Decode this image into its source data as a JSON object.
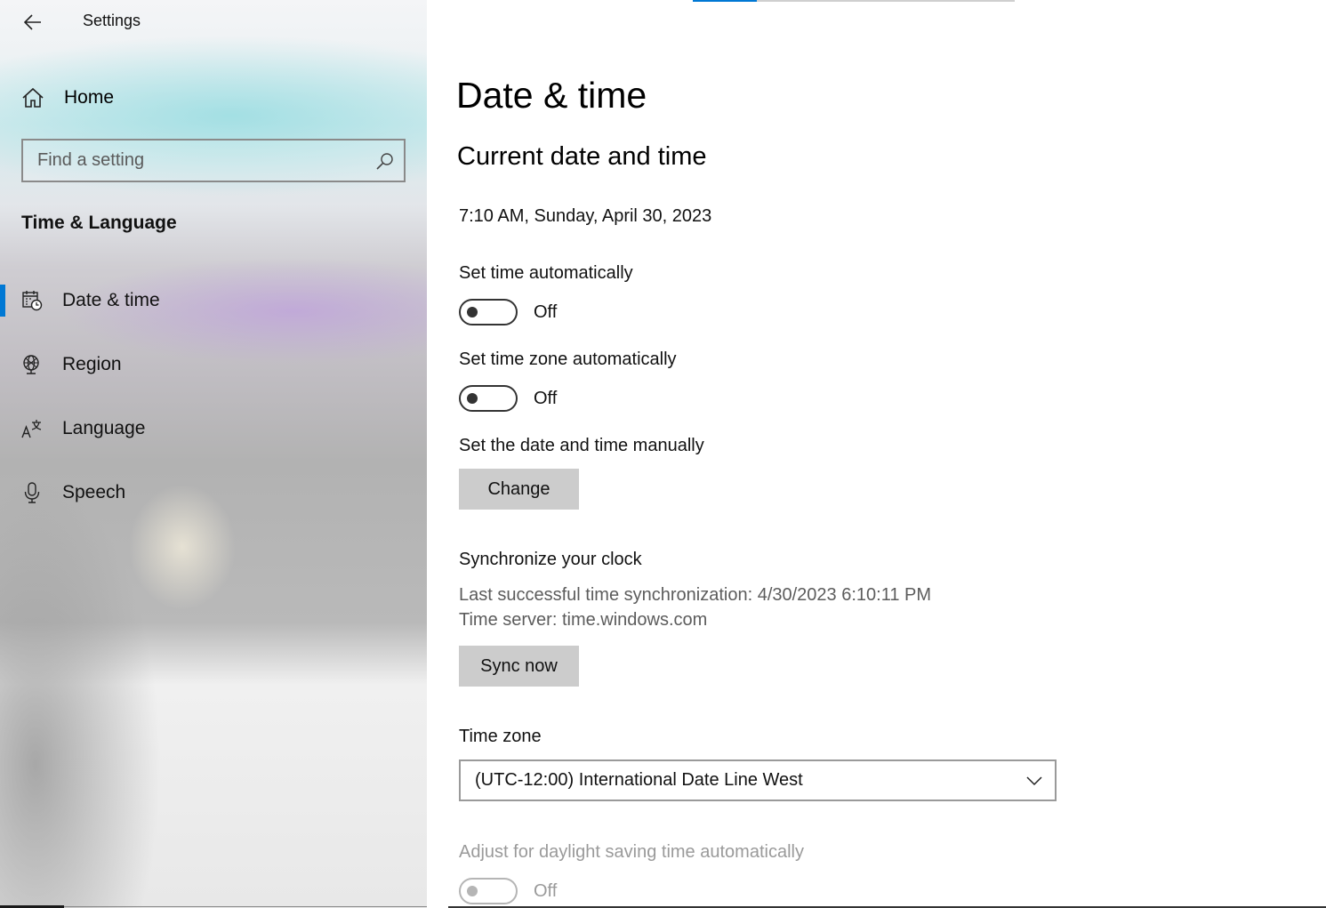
{
  "window": {
    "title": "Settings"
  },
  "sidebar": {
    "home_label": "Home",
    "search_placeholder": "Find a setting",
    "section_title": "Time & Language",
    "items": [
      {
        "label": "Date & time",
        "icon": "calendar-clock-icon",
        "active": true
      },
      {
        "label": "Region",
        "icon": "globe-icon",
        "active": false
      },
      {
        "label": "Language",
        "icon": "language-icon",
        "active": false
      },
      {
        "label": "Speech",
        "icon": "microphone-icon",
        "active": false
      }
    ]
  },
  "main": {
    "title": "Date & time",
    "subtitle": "Current date and time",
    "current_datetime": "7:10 AM, Sunday, April 30, 2023",
    "set_time_auto": {
      "label": "Set time automatically",
      "state": "Off"
    },
    "set_timezone_auto": {
      "label": "Set time zone automatically",
      "state": "Off"
    },
    "manual": {
      "label": "Set the date and time manually",
      "button": "Change"
    },
    "sync": {
      "title": "Synchronize your clock",
      "last_sync": "Last successful time synchronization: 4/30/2023 6:10:11 PM",
      "server": "Time server: time.windows.com",
      "button": "Sync now"
    },
    "timezone": {
      "label": "Time zone",
      "value": "(UTC-12:00) International Date Line West"
    },
    "dst": {
      "label": "Adjust for daylight saving time automatically",
      "state": "Off"
    }
  },
  "colors": {
    "accent": "#0078d4",
    "button_bg": "#cccccc",
    "disabled_text": "#9a9a9a"
  }
}
